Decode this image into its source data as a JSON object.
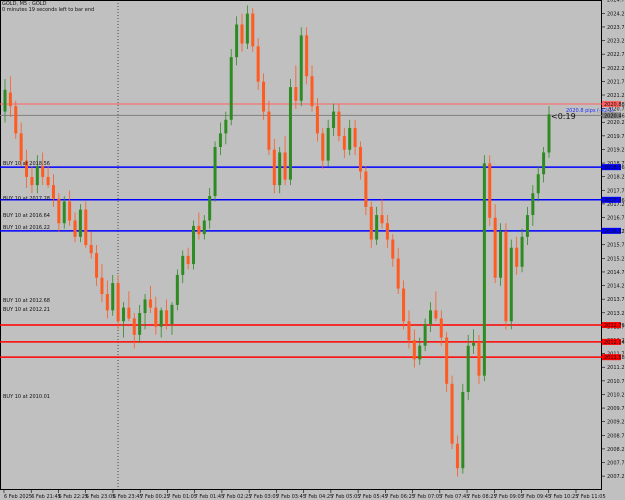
{
  "header": {
    "symbol_line": "GOLD, M5 : GOLD",
    "countdown_line": "0 minutes 19 seconds left to bar end"
  },
  "timer_label": "<0:19",
  "colors": {
    "background": "#c0c0c0",
    "bull": "#2e8b22",
    "bear": "#ff5a1f",
    "buy_line": "#0000ff",
    "sell_line": "#ff0000",
    "price_line": "#808080",
    "grid": "#000000"
  },
  "chart_data": {
    "type": "candlestick",
    "title": "",
    "xlabel": "",
    "ylabel": "",
    "ylim": [
      2006.7,
      2024.7
    ],
    "y_ticks": [
      "2024.71",
      "2024.21",
      "2023.71",
      "2023.21",
      "2022.71",
      "2022.21",
      "2021.71",
      "2021.21",
      "2020.71",
      "2020.21",
      "2019.71",
      "2019.21",
      "2018.71",
      "2018.21",
      "2017.71",
      "2017.21",
      "2016.71",
      "2016.21",
      "2015.71",
      "2015.21",
      "2014.71",
      "2014.21",
      "2013.71",
      "2013.21",
      "2012.71",
      "2012.21",
      "2011.71",
      "2011.21",
      "2010.71",
      "2010.21",
      "2009.71",
      "2009.21",
      "2008.71",
      "2008.21",
      "2007.71",
      "2007.21"
    ],
    "x_ticks": [
      "6 Feb 2025",
      "6 Feb 21:45",
      "6 Feb 22:25",
      "6 Feb 23:05",
      "6 Feb 23:45",
      "7 Feb 00:25",
      "7 Feb 01:05",
      "7 Feb 01:45",
      "7 Feb 02:25",
      "7 Feb 03:05",
      "7 Feb 03:45",
      "7 Feb 04:25",
      "7 Feb 05:05",
      "7 Feb 05:45",
      "7 Feb 06:25",
      "7 Feb 07:05",
      "7 Feb 07:45",
      "7 Feb 08:25",
      "7 Feb 09:05",
      "7 Feb 09:45",
      "7 Feb 10:25",
      "7 Feb 11:05"
    ],
    "hlines": [
      {
        "price": 2020.88,
        "label": "2020.88",
        "color": "#ff6060",
        "width": 1
      },
      {
        "price": 2020.46,
        "label": "2020.46",
        "color": "#808080",
        "width": 1
      },
      {
        "price": 2018.56,
        "label": "2018.56",
        "color": "#0000ff",
        "width": 1.5
      },
      {
        "price": 2017.36,
        "label": "2017.36",
        "color": "#0000ff",
        "width": 1.5
      },
      {
        "price": 2016.22,
        "label": "2016.22",
        "color": "#0000ff",
        "width": 1.5
      },
      {
        "price": 2012.76,
        "label": "2012.76",
        "color": "#ff0000",
        "width": 1.5
      },
      {
        "price": 2012.14,
        "label": "2012.14",
        "color": "#ff0000",
        "width": 1.5
      },
      {
        "price": 2011.58,
        "label": "2011.58",
        "color": "#ff0000",
        "width": 1.5
      }
    ],
    "order_labels": [
      {
        "text": "BUY 10 at 2018.56",
        "price": 2018.56
      },
      {
        "text": "BUY 10 at 2017.28",
        "price": 2017.28
      },
      {
        "text": "BUY 10 at 2016.64",
        "price": 2016.64
      },
      {
        "text": "BUY 10 at 2016.22",
        "price": 2016.22
      },
      {
        "text": "BUY 10 at 2012.68",
        "price": 2013.52
      },
      {
        "text": "BUY 10 at 2012.21",
        "price": 2013.21
      },
      {
        "text": "BUY 10 at 2010.01",
        "price": 2010.01
      }
    ],
    "pips_label": "2020.8 pips (-42.1)",
    "candles": [
      [
        2020.6,
        2021.8,
        2020.2,
        2021.4
      ],
      [
        2021.3,
        2021.9,
        2020.4,
        2020.8
      ],
      [
        2020.8,
        2021.0,
        2019.6,
        2019.8
      ],
      [
        2019.8,
        2020.2,
        2018.6,
        2018.8
      ],
      [
        2018.8,
        2019.2,
        2017.8,
        2018.2
      ],
      [
        2018.2,
        2018.6,
        2017.6,
        2017.9
      ],
      [
        2017.9,
        2019.0,
        2017.6,
        2018.6
      ],
      [
        2018.6,
        2019.1,
        2017.9,
        2018.2
      ],
      [
        2018.2,
        2018.6,
        2017.8,
        2017.9
      ],
      [
        2017.9,
        2018.3,
        2017.1,
        2017.4
      ],
      [
        2017.4,
        2017.6,
        2016.2,
        2016.5
      ],
      [
        2016.5,
        2017.5,
        2016.3,
        2017.3
      ],
      [
        2017.3,
        2017.7,
        2016.4,
        2016.6
      ],
      [
        2016.6,
        2016.9,
        2015.8,
        2016.0
      ],
      [
        2016.0,
        2017.2,
        2015.8,
        2017.0
      ],
      [
        2017.0,
        2017.3,
        2015.6,
        2015.7
      ],
      [
        2015.7,
        2016.2,
        2015.2,
        2015.4
      ],
      [
        2015.4,
        2015.7,
        2014.2,
        2014.5
      ],
      [
        2014.5,
        2015.0,
        2013.6,
        2013.9
      ],
      [
        2013.9,
        2014.4,
        2013.0,
        2013.3
      ],
      [
        2013.3,
        2014.6,
        2013.1,
        2014.3
      ],
      [
        2014.3,
        2014.6,
        2012.6,
        2012.9
      ],
      [
        2012.9,
        2013.6,
        2012.3,
        2013.4
      ],
      [
        2013.4,
        2014.0,
        2012.9,
        2013.0
      ],
      [
        2013.0,
        2013.2,
        2011.9,
        2012.4
      ],
      [
        2012.4,
        2013.5,
        2012.1,
        2013.2
      ],
      [
        2013.2,
        2013.9,
        2012.6,
        2013.7
      ],
      [
        2013.7,
        2014.2,
        2013.2,
        2013.4
      ],
      [
        2013.4,
        2013.8,
        2012.4,
        2012.7
      ],
      [
        2012.7,
        2013.4,
        2012.3,
        2013.3
      ],
      [
        2013.3,
        2013.7,
        2012.6,
        2012.8
      ],
      [
        2012.8,
        2013.6,
        2012.4,
        2013.5
      ],
      [
        2013.5,
        2014.8,
        2013.3,
        2014.6
      ],
      [
        2014.6,
        2015.5,
        2014.3,
        2015.3
      ],
      [
        2015.3,
        2015.6,
        2014.8,
        2015.0
      ],
      [
        2015.0,
        2016.6,
        2014.8,
        2016.4
      ],
      [
        2016.4,
        2016.9,
        2015.9,
        2016.1
      ],
      [
        2016.1,
        2016.8,
        2015.9,
        2016.6
      ],
      [
        2016.6,
        2017.8,
        2016.3,
        2017.5
      ],
      [
        2017.5,
        2019.5,
        2017.3,
        2019.3
      ],
      [
        2019.3,
        2020.2,
        2019.0,
        2019.8
      ],
      [
        2019.8,
        2020.6,
        2019.4,
        2020.3
      ],
      [
        2020.3,
        2022.9,
        2020.1,
        2022.6
      ],
      [
        2022.6,
        2024.1,
        2022.3,
        2023.8
      ],
      [
        2023.8,
        2024.2,
        2022.8,
        2023.1
      ],
      [
        2023.1,
        2024.5,
        2022.9,
        2024.2
      ],
      [
        2024.2,
        2024.4,
        2022.8,
        2023.0
      ],
      [
        2023.0,
        2023.3,
        2021.4,
        2021.7
      ],
      [
        2021.7,
        2022.0,
        2020.3,
        2020.6
      ],
      [
        2020.6,
        2021.0,
        2019.0,
        2019.2
      ],
      [
        2019.2,
        2019.6,
        2017.6,
        2017.9
      ],
      [
        2017.9,
        2019.3,
        2017.6,
        2019.1
      ],
      [
        2019.1,
        2019.7,
        2017.9,
        2018.1
      ],
      [
        2018.1,
        2021.8,
        2017.9,
        2021.5
      ],
      [
        2021.5,
        2022.3,
        2020.7,
        2021.0
      ],
      [
        2021.0,
        2023.7,
        2020.8,
        2023.4
      ],
      [
        2023.4,
        2023.7,
        2021.6,
        2021.9
      ],
      [
        2021.9,
        2022.3,
        2020.6,
        2020.8
      ],
      [
        2020.8,
        2021.1,
        2019.5,
        2019.8
      ],
      [
        2019.8,
        2020.0,
        2018.5,
        2018.8
      ],
      [
        2018.8,
        2020.3,
        2018.6,
        2020.0
      ],
      [
        2020.0,
        2020.9,
        2019.7,
        2020.6
      ],
      [
        2020.6,
        2020.9,
        2019.5,
        2019.7
      ],
      [
        2019.7,
        2020.0,
        2018.9,
        2019.2
      ],
      [
        2019.2,
        2020.3,
        2019.0,
        2020.0
      ],
      [
        2020.0,
        2020.3,
        2019.0,
        2019.3
      ],
      [
        2019.3,
        2019.5,
        2018.1,
        2018.4
      ],
      [
        2018.4,
        2018.6,
        2016.8,
        2017.1
      ],
      [
        2017.1,
        2017.3,
        2015.6,
        2015.9
      ],
      [
        2015.9,
        2017.1,
        2015.7,
        2016.8
      ],
      [
        2016.8,
        2017.4,
        2016.3,
        2016.5
      ],
      [
        2016.5,
        2016.8,
        2015.6,
        2015.9
      ],
      [
        2015.9,
        2016.1,
        2014.9,
        2015.2
      ],
      [
        2015.2,
        2015.6,
        2013.9,
        2014.1
      ],
      [
        2014.1,
        2014.4,
        2012.6,
        2012.9
      ],
      [
        2012.9,
        2013.3,
        2011.9,
        2012.2
      ],
      [
        2012.2,
        2012.6,
        2011.2,
        2011.5
      ],
      [
        2011.5,
        2012.3,
        2011.3,
        2012.0
      ],
      [
        2012.0,
        2013.0,
        2011.8,
        2012.8
      ],
      [
        2012.8,
        2013.6,
        2012.5,
        2013.3
      ],
      [
        2013.3,
        2014.0,
        2012.9,
        2013.0
      ],
      [
        2013.0,
        2013.3,
        2012.0,
        2012.3
      ],
      [
        2012.3,
        2012.5,
        2010.3,
        2010.6
      ],
      [
        2010.6,
        2010.9,
        2008.2,
        2008.4
      ],
      [
        2008.4,
        2008.7,
        2007.2,
        2007.5
      ],
      [
        2007.5,
        2010.6,
        2007.3,
        2010.3
      ],
      [
        2010.3,
        2012.4,
        2010.0,
        2012.0
      ],
      [
        2012.0,
        2012.6,
        2011.7,
        2012.1
      ],
      [
        2012.1,
        2012.4,
        2010.6,
        2010.9
      ],
      [
        2010.9,
        2019.0,
        2010.7,
        2018.7
      ],
      [
        2018.7,
        2019.0,
        2016.4,
        2016.7
      ],
      [
        2016.7,
        2017.2,
        2014.3,
        2014.5
      ],
      [
        2014.5,
        2016.5,
        2014.2,
        2016.2
      ],
      [
        2016.2,
        2016.5,
        2012.6,
        2012.9
      ],
      [
        2012.9,
        2015.9,
        2012.6,
        2015.6
      ],
      [
        2015.6,
        2016.0,
        2014.6,
        2014.9
      ],
      [
        2014.9,
        2016.3,
        2014.7,
        2016.0
      ],
      [
        2016.0,
        2017.1,
        2015.7,
        2016.8
      ],
      [
        2016.8,
        2017.9,
        2016.4,
        2017.6
      ],
      [
        2017.6,
        2018.6,
        2017.3,
        2018.3
      ],
      [
        2018.3,
        2019.3,
        2018.0,
        2019.1
      ],
      [
        2019.1,
        2020.8,
        2018.9,
        2020.5
      ]
    ]
  }
}
